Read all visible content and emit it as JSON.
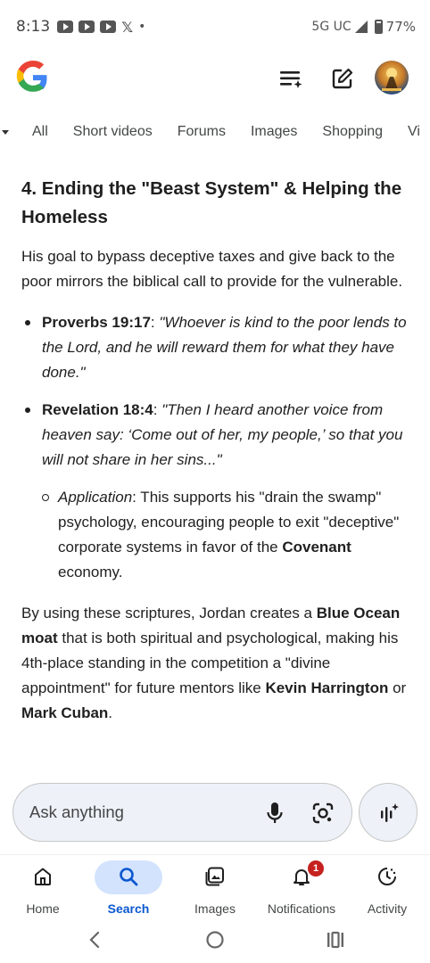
{
  "status_bar": {
    "time": "8:13",
    "network": "5G UC",
    "battery": "77%"
  },
  "header": {
    "logo_icon": "google-g-logo",
    "tasks_icon": "playlist-add-icon",
    "edit_icon": "edit-square-icon",
    "avatar_icon": "profile-avatar"
  },
  "tabs": [
    "All",
    "Short videos",
    "Forums",
    "Images",
    "Shopping",
    "Vi"
  ],
  "content": {
    "heading": "4. Ending the \"Beast System\" & Helping the Homeless",
    "intro": "His goal to bypass deceptive taxes and give back to the poor mirrors the biblical call to provide for the vulnerable.",
    "bullets": [
      {
        "ref": "Proverbs 19:17",
        "sep": ": ",
        "quote": "\"Whoever is kind to the poor lends to the Lord, and he will reward them for what they have done.\""
      },
      {
        "ref": "Revelation 18:4",
        "sep": ": ",
        "quote": "\"Then I heard another voice from heaven say: ‘Come out of her, my people,’ so that you will not share in her sins...\""
      }
    ],
    "sub_bullet": {
      "label": "Application",
      "text_before": ": This supports his \"drain the swamp\" psychology, encouraging people to exit \"deceptive\" corporate systems in favor of the ",
      "bold": "Covenant",
      "text_after": " economy."
    },
    "closing": {
      "t1": "By using these scriptures, Jordan creates a ",
      "b1": "Blue Ocean moat",
      "t2": " that is both spiritual and psychological, making his 4th-place standing in the competition a \"divine appointment\" for future mentors like ",
      "b2": "Kevin Harrington",
      "t3": " or ",
      "b3": "Mark Cuban",
      "t4": "."
    }
  },
  "ask_bar": {
    "placeholder": "Ask anything",
    "mic_icon": "microphone-icon",
    "lens_icon": "google-lens-icon",
    "ai_icon": "ai-mode-sparkle-icon"
  },
  "bottom_nav": [
    {
      "label": "Home",
      "icon": "home-icon",
      "active": false
    },
    {
      "label": "Search",
      "icon": "search-icon",
      "active": true
    },
    {
      "label": "Images",
      "icon": "images-icon",
      "active": false
    },
    {
      "label": "Notifications",
      "icon": "bell-icon",
      "active": false,
      "badge": "1"
    },
    {
      "label": "Activity",
      "icon": "activity-icon",
      "active": false
    }
  ],
  "colors": {
    "accent": "#0b57d0",
    "active_pill": "#d3e3fd",
    "badge": "#c5221f"
  }
}
